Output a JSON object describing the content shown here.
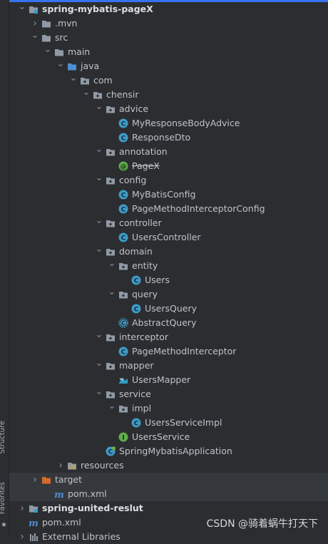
{
  "side_tabs": {
    "structure": "Structure",
    "favorites": "Favorites"
  },
  "watermark": "CSDN @骑着蜗牛打天下",
  "colors": {
    "accent": "#3574f0",
    "folder": "#8f9aa6",
    "blue_folder": "#4b8fd6",
    "class": "#3e9bc8",
    "excluded": "#d46b2a"
  },
  "tree": [
    {
      "label": "spring-mybatis-pageX",
      "icon": "module-folder",
      "depth": 1,
      "arrow": "down",
      "bold": true,
      "selected": false
    },
    {
      "label": ".mvn",
      "icon": "folder",
      "depth": 2,
      "arrow": "right"
    },
    {
      "label": "src",
      "icon": "folder",
      "depth": 2,
      "arrow": "down"
    },
    {
      "label": "main",
      "icon": "folder",
      "depth": 3,
      "arrow": "down"
    },
    {
      "label": "java",
      "icon": "source-folder",
      "depth": 4,
      "arrow": "down"
    },
    {
      "label": "com",
      "icon": "package",
      "depth": 5,
      "arrow": "down"
    },
    {
      "label": "chensir",
      "icon": "package",
      "depth": 6,
      "arrow": "down"
    },
    {
      "label": "advice",
      "icon": "package",
      "depth": 7,
      "arrow": "down"
    },
    {
      "label": "MyResponseBodyAdvice",
      "icon": "class",
      "depth": 8,
      "arrow": "none"
    },
    {
      "label": "ResponseDto",
      "icon": "class",
      "depth": 8,
      "arrow": "none"
    },
    {
      "label": "annotation",
      "icon": "package",
      "depth": 7,
      "arrow": "down"
    },
    {
      "label": "PageX",
      "icon": "annotation",
      "depth": 8,
      "arrow": "none",
      "strike": true
    },
    {
      "label": "config",
      "icon": "package",
      "depth": 7,
      "arrow": "down"
    },
    {
      "label": "MyBatisConfig",
      "icon": "class",
      "depth": 8,
      "arrow": "none"
    },
    {
      "label": "PageMethodInterceptorConfig",
      "icon": "class",
      "depth": 8,
      "arrow": "none"
    },
    {
      "label": "controller",
      "icon": "package",
      "depth": 7,
      "arrow": "down"
    },
    {
      "label": "UsersController",
      "icon": "class",
      "depth": 8,
      "arrow": "none"
    },
    {
      "label": "domain",
      "icon": "package",
      "depth": 7,
      "arrow": "down"
    },
    {
      "label": "entity",
      "icon": "package",
      "depth": 8,
      "arrow": "down"
    },
    {
      "label": "Users",
      "icon": "class",
      "depth": 9,
      "arrow": "none"
    },
    {
      "label": "query",
      "icon": "package",
      "depth": 8,
      "arrow": "down"
    },
    {
      "label": "UsersQuery",
      "icon": "class",
      "depth": 9,
      "arrow": "none"
    },
    {
      "label": "AbstractQuery",
      "icon": "abstract-class",
      "depth": 8,
      "arrow": "none"
    },
    {
      "label": "interceptor",
      "icon": "package",
      "depth": 7,
      "arrow": "down"
    },
    {
      "label": "PageMethodInterceptor",
      "icon": "class",
      "depth": 8,
      "arrow": "none"
    },
    {
      "label": "mapper",
      "icon": "package",
      "depth": 7,
      "arrow": "down"
    },
    {
      "label": "UsersMapper",
      "icon": "mapper",
      "depth": 8,
      "arrow": "none"
    },
    {
      "label": "service",
      "icon": "package",
      "depth": 7,
      "arrow": "down"
    },
    {
      "label": "impl",
      "icon": "package",
      "depth": 8,
      "arrow": "down"
    },
    {
      "label": "UsersServiceImpl",
      "icon": "class",
      "depth": 9,
      "arrow": "none"
    },
    {
      "label": "UsersService",
      "icon": "interface",
      "depth": 8,
      "arrow": "none"
    },
    {
      "label": "SpringMybatisApplication",
      "icon": "spring-class",
      "depth": 7,
      "arrow": "none"
    },
    {
      "label": "resources",
      "icon": "resources-folder",
      "depth": 4,
      "arrow": "right"
    },
    {
      "label": "target",
      "icon": "excluded-folder",
      "depth": 2,
      "arrow": "right",
      "selected": true
    },
    {
      "label": "pom.xml",
      "icon": "maven",
      "depth": 3,
      "arrow": "none",
      "selected": true
    },
    {
      "label": "spring-united-reslut",
      "icon": "module-folder",
      "depth": 1,
      "arrow": "right",
      "bold": true
    },
    {
      "label": "pom.xml",
      "icon": "maven",
      "depth": 1,
      "arrow": "none"
    },
    {
      "label": "External Libraries",
      "icon": "libraries",
      "depth": 1,
      "arrow": "right"
    }
  ]
}
